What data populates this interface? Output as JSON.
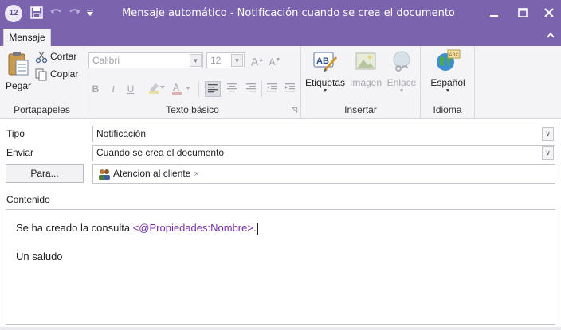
{
  "window": {
    "app_icon_text": "12",
    "title": "Mensaje automático - Notificación cuando se crea el documento"
  },
  "tabs": [
    {
      "label": "Mensaje",
      "selected": true
    }
  ],
  "ribbon": {
    "clipboard": {
      "paste_label": "Pegar",
      "cut_label": "Cortar",
      "copy_label": "Copiar",
      "group_label": "Portapapeles"
    },
    "text": {
      "font_value": "Calibri",
      "size_value": "12",
      "grow_label": "A",
      "shrink_label": "A",
      "bold_label": "B",
      "italic_label": "I",
      "underline_label": "U",
      "group_label": "Texto básico"
    },
    "insert": {
      "tags_label": "Etiquetas",
      "image_label": "Imagen",
      "link_label": "Enlace",
      "group_label": "Insertar"
    },
    "language": {
      "language_label": "Español",
      "group_label": "Idioma"
    }
  },
  "form": {
    "type_label": "Tipo",
    "type_value": "Notificación",
    "send_label": "Enviar",
    "send_value": "Cuando se crea el documento",
    "to_button": "Para...",
    "recipient": "Atencion al cliente",
    "content_label": "Contenido"
  },
  "content": {
    "line1_text": "Se ha creado la consulta ",
    "line1_token": "<@Propiedades:Nombre>",
    "line1_end": ".",
    "line2": "Un saludo"
  },
  "colors": {
    "titlebar": "#7b63ad",
    "ribbon_bg": "#f4f4f7",
    "token": "#7a2ca8"
  }
}
